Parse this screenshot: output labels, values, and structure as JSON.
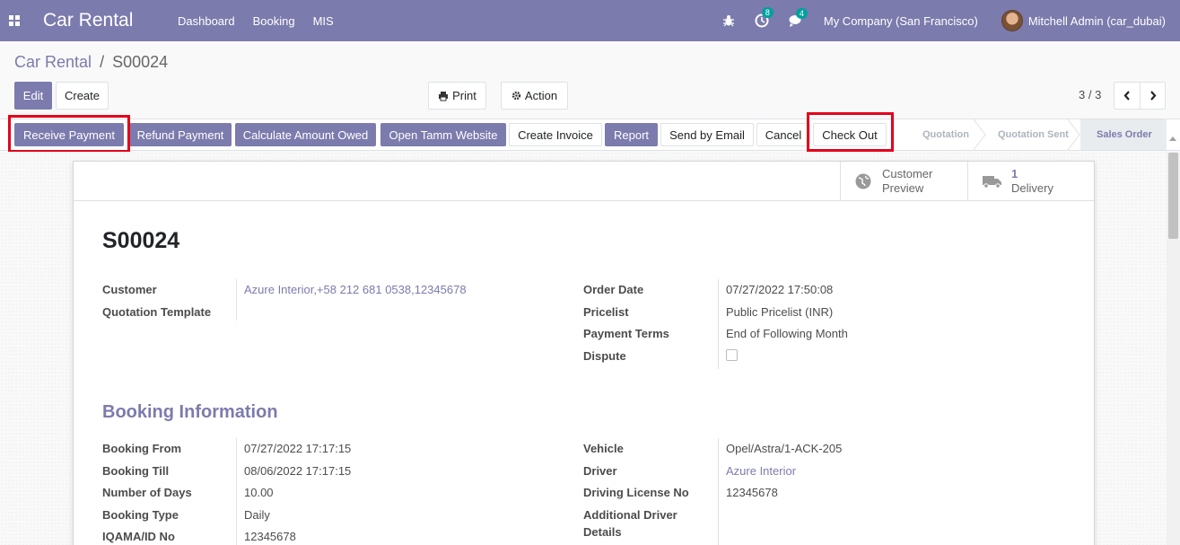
{
  "nav": {
    "app_name": "Car Rental",
    "menu": [
      "Dashboard",
      "Booking",
      "MIS"
    ],
    "activity_count": "8",
    "message_count": "4",
    "company": "My Company (San Francisco)",
    "user": "Mitchell Admin (car_dubai)"
  },
  "breadcrumb": {
    "parent": "Car Rental",
    "separator": "/",
    "current": "S00024"
  },
  "control": {
    "edit": "Edit",
    "create": "Create",
    "print": "Print",
    "action": "Action",
    "pager": "3 / 3"
  },
  "statusbar": {
    "buttons": [
      "Receive Payment",
      "Refund Payment",
      "Calculate Amount Owed",
      "Open Tamm Website",
      "Create Invoice",
      "Report",
      "Send by Email",
      "Cancel",
      "Check Out"
    ],
    "stages": [
      "Quotation",
      "Quotation Sent",
      "Sales Order"
    ],
    "active_stage": "Sales Order"
  },
  "smart_buttons": {
    "customer_preview_line1": "Customer",
    "customer_preview_line2": "Preview",
    "delivery_count": "1",
    "delivery_label": "Delivery"
  },
  "record": {
    "name": "S00024",
    "customer_label": "Customer",
    "customer_value": "Azure Interior,+58 212 681 0538,12345678",
    "template_label": "Quotation Template",
    "order_date_label": "Order Date",
    "order_date_value": "07/27/2022 17:50:08",
    "pricelist_label": "Pricelist",
    "pricelist_value": "Public Pricelist (INR)",
    "payment_terms_label": "Payment Terms",
    "payment_terms_value": "End of Following Month",
    "dispute_label": "Dispute",
    "dispute_checked": false
  },
  "booking": {
    "section_title": "Booking Information",
    "from_label": "Booking From",
    "from_value": "07/27/2022 17:17:15",
    "till_label": "Booking Till",
    "till_value": "08/06/2022 17:17:15",
    "days_label": "Number of Days",
    "days_value": "10.00",
    "type_label": "Booking Type",
    "type_value": "Daily",
    "iqama_label": "IQAMA/ID No",
    "iqama_value": "12345678",
    "vehicle_label": "Vehicle",
    "vehicle_value": "Opel/Astra/1-ACK-205",
    "driver_label": "Driver",
    "driver_value": "Azure Interior",
    "license_label": "Driving License No",
    "license_value": "12345678",
    "addl_driver_label_1": "Additional Driver",
    "addl_driver_label_2": "Details"
  },
  "colors": {
    "brand": "#7c7bad",
    "highlight": "#e3001b",
    "badge": "#00a09d"
  }
}
